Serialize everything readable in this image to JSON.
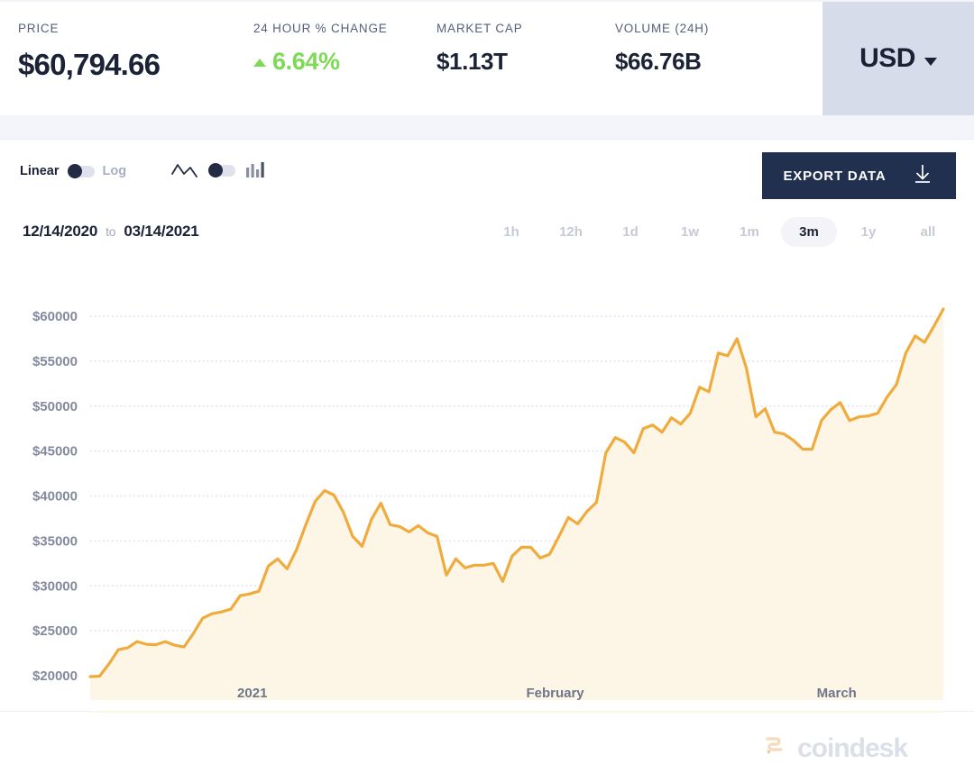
{
  "header": {
    "stats": [
      {
        "label": "PRICE",
        "value": "$60,794.66"
      },
      {
        "label": "24 HOUR % CHANGE",
        "value": "6.64%",
        "direction": "up",
        "color": "#7ed957"
      },
      {
        "label": "MARKET CAP",
        "value": "$1.13T"
      },
      {
        "label": "VOLUME (24H)",
        "value": "$66.76B"
      }
    ],
    "currency_selector": {
      "label": "USD",
      "icon": "chevron-down-icon"
    }
  },
  "toolbar": {
    "scale_toggle": {
      "left_label": "Linear",
      "right_label": "Log",
      "selected": "Linear"
    },
    "type_toggle": {
      "left_icon": "line-chart-icon",
      "right_icon": "bar-chart-icon",
      "selected": "line"
    },
    "export": {
      "label": "EXPORT DATA",
      "icon": "download-icon",
      "bg": "#22304f"
    }
  },
  "date_row": {
    "start_date": "12/14/2020",
    "separator": "to",
    "end_date": "03/14/2021",
    "ranges": [
      "1h",
      "12h",
      "1d",
      "1w",
      "1m",
      "3m",
      "1y",
      "all"
    ],
    "selected_range": "3m"
  },
  "watermark": {
    "text": "coindesk",
    "icon": "coindesk-logo-icon"
  },
  "chart_data": {
    "type": "area",
    "title": "",
    "xlabel": "",
    "ylabel": "",
    "line_color": "#f0ab3d",
    "fill_color": "#fdf5e6",
    "grid": true,
    "legend": "none",
    "ylim": [
      20000,
      60000
    ],
    "yticks": [
      20000,
      25000,
      30000,
      35000,
      40000,
      45000,
      50000,
      55000,
      60000
    ],
    "ytick_labels": [
      "$20000",
      "$25000",
      "$30000",
      "$35000",
      "$40000",
      "$45000",
      "$50000",
      "$55000",
      "$60000"
    ],
    "xtick_labels": [
      "2021",
      "February",
      "March"
    ],
    "xtick_positions": [
      0.19,
      0.545,
      0.875
    ],
    "x_start": "12/14/2020",
    "x_end": "03/14/2021",
    "x": [
      "12/14/2020",
      "12/15/2020",
      "12/16/2020",
      "12/17/2020",
      "12/18/2020",
      "12/19/2020",
      "12/20/2020",
      "12/21/2020",
      "12/22/2020",
      "12/23/2020",
      "12/24/2020",
      "12/25/2020",
      "12/26/2020",
      "12/27/2020",
      "12/28/2020",
      "12/29/2020",
      "12/30/2020",
      "12/31/2020",
      "01/01/2021",
      "01/02/2021",
      "01/03/2021",
      "01/04/2021",
      "01/05/2021",
      "01/06/2021",
      "01/07/2021",
      "01/08/2021",
      "01/09/2021",
      "01/10/2021",
      "01/11/2021",
      "01/12/2021",
      "01/13/2021",
      "01/14/2021",
      "01/15/2021",
      "01/16/2021",
      "01/17/2021",
      "01/18/2021",
      "01/19/2021",
      "01/20/2021",
      "01/21/2021",
      "01/22/2021",
      "01/23/2021",
      "01/24/2021",
      "01/25/2021",
      "01/26/2021",
      "01/27/2021",
      "01/28/2021",
      "01/29/2021",
      "01/30/2021",
      "01/31/2021",
      "02/01/2021",
      "02/02/2021",
      "02/03/2021",
      "02/04/2021",
      "02/05/2021",
      "02/06/2021",
      "02/07/2021",
      "02/08/2021",
      "02/09/2021",
      "02/10/2021",
      "02/11/2021",
      "02/12/2021",
      "02/13/2021",
      "02/14/2021",
      "02/15/2021",
      "02/16/2021",
      "02/17/2021",
      "02/18/2021",
      "02/19/2021",
      "02/20/2021",
      "02/21/2021",
      "02/22/2021",
      "02/23/2021",
      "02/24/2021",
      "02/25/2021",
      "02/26/2021",
      "02/27/2021",
      "02/28/2021",
      "03/01/2021",
      "03/02/2021",
      "03/03/2021",
      "03/04/2021",
      "03/05/2021",
      "03/06/2021",
      "03/07/2021",
      "03/08/2021",
      "03/09/2021",
      "03/10/2021",
      "03/11/2021",
      "03/12/2021",
      "03/13/2021",
      "03/14/2021"
    ],
    "values": [
      19900,
      19950,
      21300,
      22900,
      23100,
      23800,
      23500,
      23450,
      23800,
      23400,
      23200,
      24700,
      26400,
      26900,
      27100,
      27400,
      28900,
      29100,
      29400,
      32200,
      33000,
      31900,
      34000,
      36800,
      39400,
      40600,
      40100,
      38200,
      35500,
      34400,
      37400,
      39200,
      36800,
      36600,
      36000,
      36700,
      35900,
      35500,
      31200,
      33000,
      32000,
      32300,
      32300,
      32500,
      30500,
      33300,
      34300,
      34300,
      33100,
      33500,
      35500,
      37600,
      36900,
      38300,
      39300,
      44800,
      46500,
      46000,
      44800,
      47500,
      47900,
      47100,
      48700,
      48000,
      49200,
      52100,
      51600,
      55900,
      55600,
      57500,
      54200,
      48800,
      49700,
      47100,
      46900,
      46200,
      45200,
      45200,
      48400,
      49600,
      50400,
      48400,
      48800,
      48900,
      49200,
      51000,
      52400,
      55900,
      57800,
      57100,
      58900,
      60800
    ],
    "last_value": 60794.66,
    "min_value": 19900,
    "max_value": 60800
  }
}
